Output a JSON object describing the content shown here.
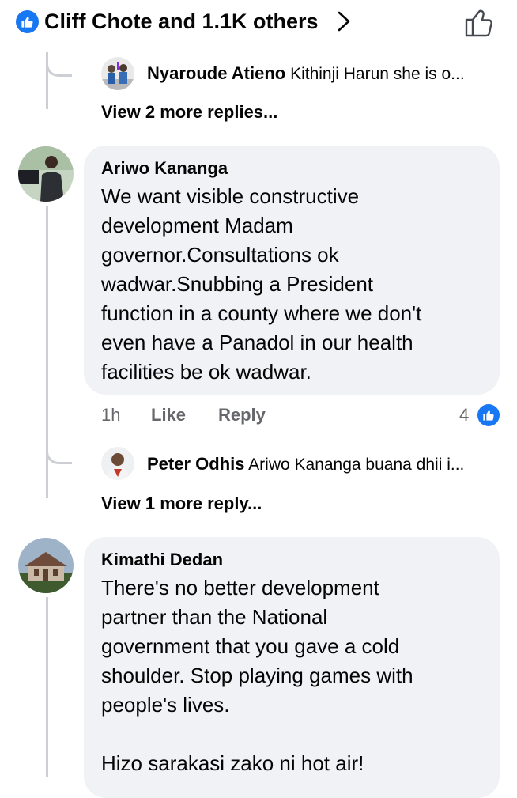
{
  "header": {
    "reactions_label": "Cliff Chote and 1.1K others"
  },
  "threads": {
    "reply1": {
      "author": "Nyaroude Atieno",
      "text": "Kithinji Harun she is o..."
    },
    "more1": "View 2 more replies...",
    "comment1": {
      "author": "Ariwo Kananga",
      "text": "We want visible constructive\ndevelopment Madam\ngovernor.Consultations ok\nwadwar.Snubbing a President\nfunction in a county where we don't\neven have a Panadol in our health\nfacilities be ok wadwar.",
      "time": "1h",
      "like_label": "Like",
      "reply_label": "Reply",
      "reaction_count": "4"
    },
    "reply2": {
      "author": "Peter Odhis",
      "text": "Ariwo Kananga buana dhii i..."
    },
    "more2": "View 1 more reply...",
    "comment2": {
      "author": "Kimathi Dedan",
      "text": "There's no better development\npartner than the National\ngovernment that you gave a cold\nshoulder. Stop playing games with\npeople's lives.\n\nHizo sarakasi zako ni hot air!"
    }
  },
  "colors": {
    "brand_blue": "#1877f2",
    "bubble_bg": "#f0f2f5",
    "secondary_text": "#65676b",
    "thread_line": "#ccd0d5"
  },
  "icons": [
    "like-icon",
    "chevron-right-icon",
    "thumbs-up-outline-icon"
  ]
}
